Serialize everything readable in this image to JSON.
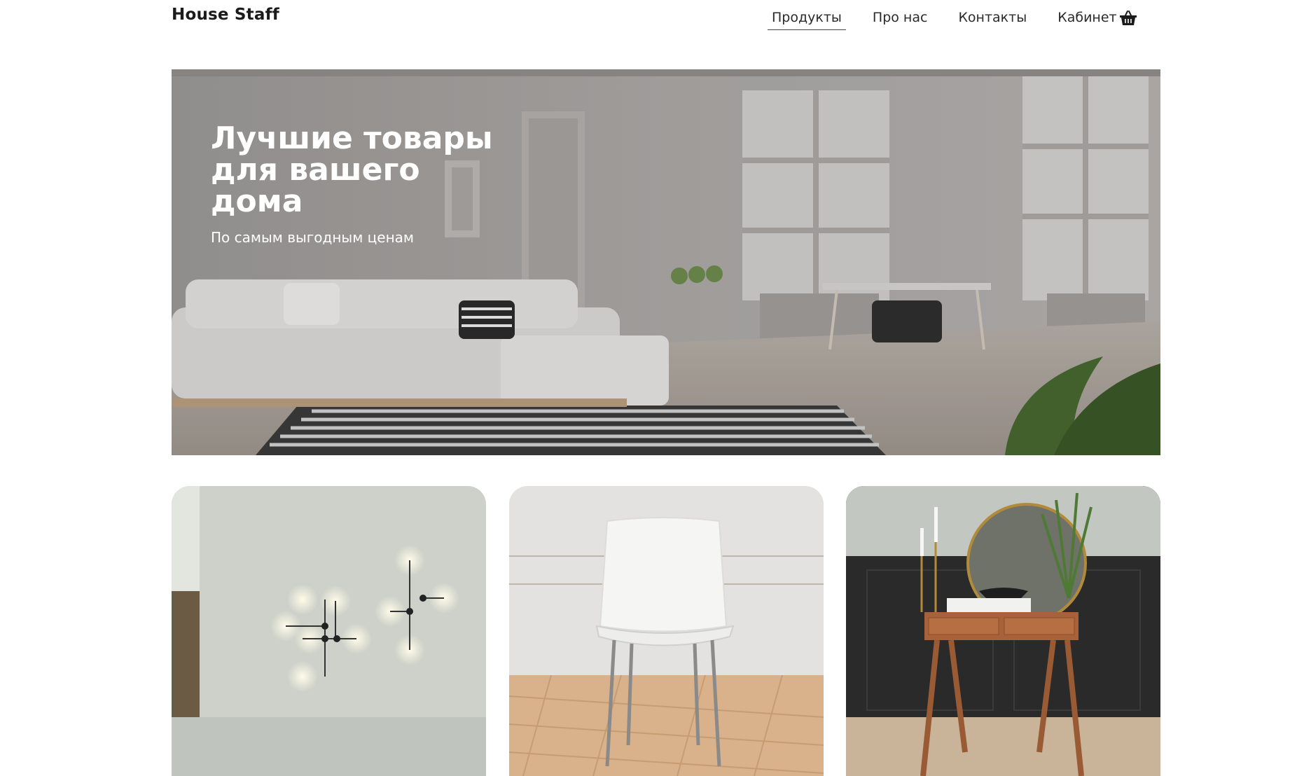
{
  "header": {
    "logo": "House Staff",
    "nav": [
      {
        "label": "Продукты",
        "active": true
      },
      {
        "label": "Про нас",
        "active": false
      },
      {
        "label": "Контакты",
        "active": false
      },
      {
        "label": "Кабинет",
        "active": false
      }
    ],
    "cart_icon": "basket-icon"
  },
  "hero": {
    "title": "Лучшие товары для вашего дома",
    "subtitle": "По самым выгодным ценам"
  },
  "products": [
    {
      "image": "wall-lamps"
    },
    {
      "image": "white-chair"
    },
    {
      "image": "wooden-console-table"
    }
  ],
  "colors": {
    "text": "#1b1b1b",
    "hero_text": "#ffffff",
    "background": "#ffffff"
  }
}
